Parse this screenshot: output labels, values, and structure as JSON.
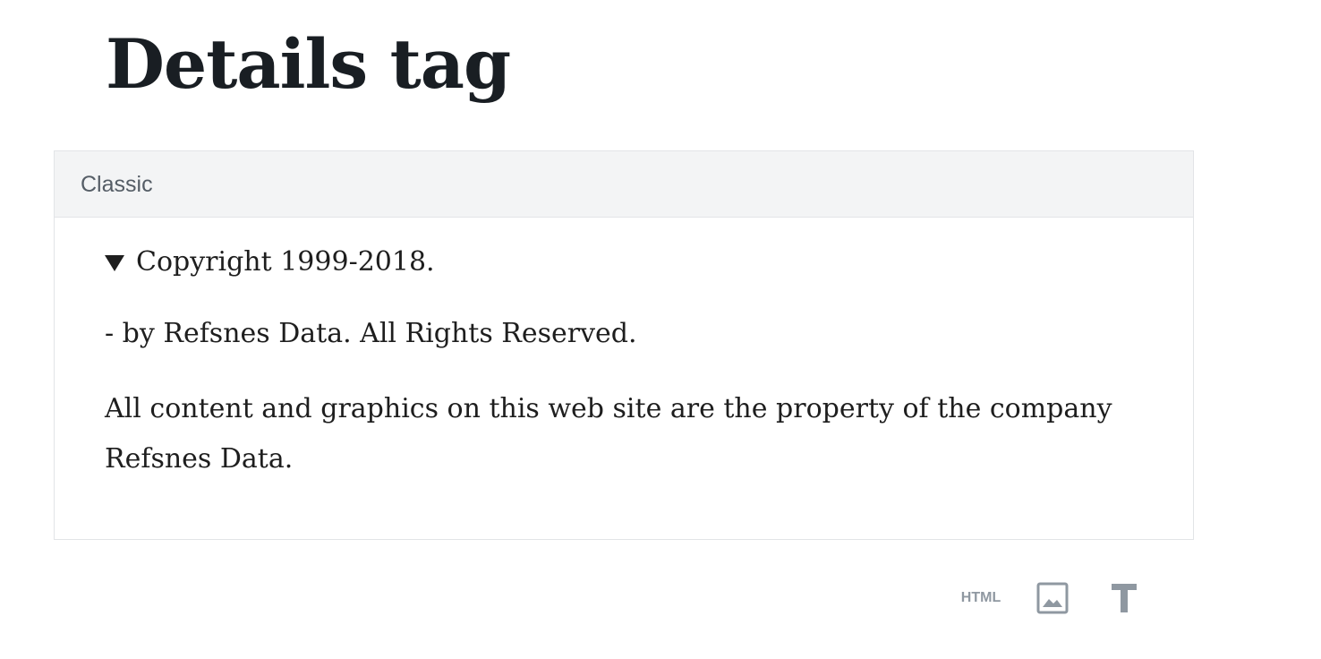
{
  "page": {
    "title": "Details tag"
  },
  "classic_block": {
    "label": "Classic",
    "details": {
      "summary": "Copyright 1999-2018.",
      "line": "- by Refsnes Data. All Rights Reserved.",
      "paragraph": "All content and graphics on this web site are the property of the company Refsnes Data."
    }
  },
  "block_tools": {
    "html_label": "HTML",
    "icons": [
      "html-icon",
      "image-icon",
      "text-icon"
    ],
    "icon_color": "#8f98a1"
  }
}
